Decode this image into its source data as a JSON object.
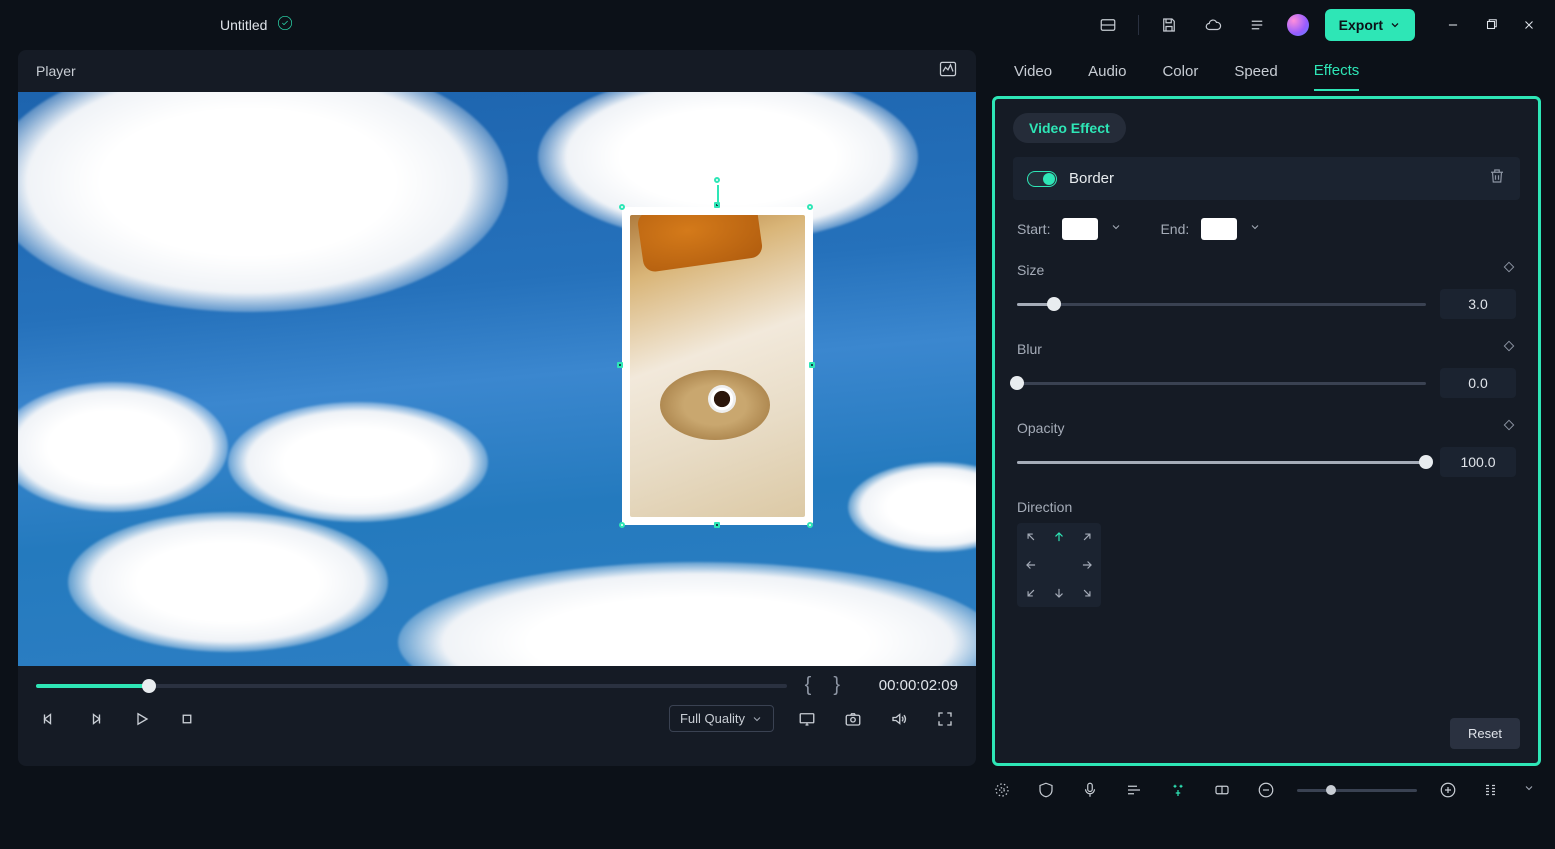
{
  "titlebar": {
    "project_title": "Untitled",
    "export_label": "Export"
  },
  "player": {
    "header_label": "Player",
    "timecode": "00:00:02:09",
    "seek_percent": 15,
    "quality_label": "Full Quality"
  },
  "inspector": {
    "tabs": [
      "Video",
      "Audio",
      "Color",
      "Speed",
      "Effects"
    ],
    "active_tab": "Effects",
    "video_effect_label": "Video Effect",
    "border": {
      "label": "Border",
      "enabled": true,
      "start_label": "Start:",
      "end_label": "End:",
      "start_color": "#ffffff",
      "end_color": "#ffffff",
      "size_label": "Size",
      "size_value": "3.0",
      "size_percent": 9,
      "blur_label": "Blur",
      "blur_value": "0.0",
      "blur_percent": 0,
      "opacity_label": "Opacity",
      "opacity_value": "100.0",
      "opacity_percent": 100,
      "direction_label": "Direction",
      "direction_active": "up"
    },
    "reset_label": "Reset"
  },
  "bottom_toolbar": {
    "zoom_percent": 28
  }
}
